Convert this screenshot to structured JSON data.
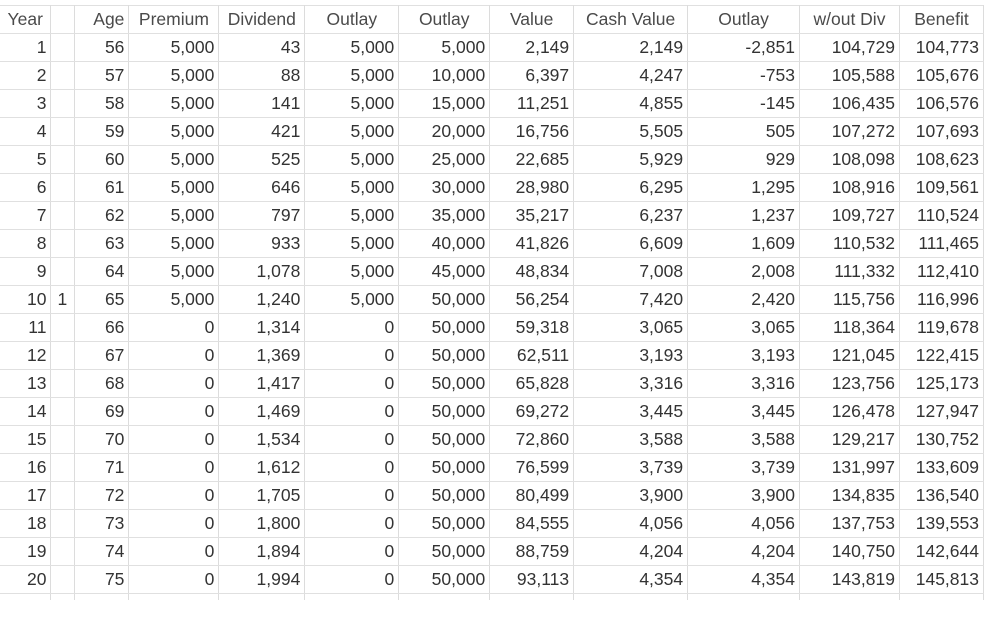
{
  "headers": [
    "Year",
    "",
    "Age",
    "Premium",
    "Dividend",
    "Outlay",
    "Outlay",
    "Value",
    "Cash Value",
    "Outlay",
    "w/out Div",
    "Benefit"
  ],
  "rows": [
    [
      "1",
      "",
      "56",
      "5,000",
      "43",
      "5,000",
      "5,000",
      "2,149",
      "2,149",
      "-2,851",
      "104,729",
      "104,773"
    ],
    [
      "2",
      "",
      "57",
      "5,000",
      "88",
      "5,000",
      "10,000",
      "6,397",
      "4,247",
      "-753",
      "105,588",
      "105,676"
    ],
    [
      "3",
      "",
      "58",
      "5,000",
      "141",
      "5,000",
      "15,000",
      "11,251",
      "4,855",
      "-145",
      "106,435",
      "106,576"
    ],
    [
      "4",
      "",
      "59",
      "5,000",
      "421",
      "5,000",
      "20,000",
      "16,756",
      "5,505",
      "505",
      "107,272",
      "107,693"
    ],
    [
      "5",
      "",
      "60",
      "5,000",
      "525",
      "5,000",
      "25,000",
      "22,685",
      "5,929",
      "929",
      "108,098",
      "108,623"
    ],
    [
      "6",
      "",
      "61",
      "5,000",
      "646",
      "5,000",
      "30,000",
      "28,980",
      "6,295",
      "1,295",
      "108,916",
      "109,561"
    ],
    [
      "7",
      "",
      "62",
      "5,000",
      "797",
      "5,000",
      "35,000",
      "35,217",
      "6,237",
      "1,237",
      "109,727",
      "110,524"
    ],
    [
      "8",
      "",
      "63",
      "5,000",
      "933",
      "5,000",
      "40,000",
      "41,826",
      "6,609",
      "1,609",
      "110,532",
      "111,465"
    ],
    [
      "9",
      "",
      "64",
      "5,000",
      "1,078",
      "5,000",
      "45,000",
      "48,834",
      "7,008",
      "2,008",
      "111,332",
      "112,410"
    ],
    [
      "10",
      "1",
      "65",
      "5,000",
      "1,240",
      "5,000",
      "50,000",
      "56,254",
      "7,420",
      "2,420",
      "115,756",
      "116,996"
    ],
    [
      "11",
      "",
      "66",
      "0",
      "1,314",
      "0",
      "50,000",
      "59,318",
      "3,065",
      "3,065",
      "118,364",
      "119,678"
    ],
    [
      "12",
      "",
      "67",
      "0",
      "1,369",
      "0",
      "50,000",
      "62,511",
      "3,193",
      "3,193",
      "121,045",
      "122,415"
    ],
    [
      "13",
      "",
      "68",
      "0",
      "1,417",
      "0",
      "50,000",
      "65,828",
      "3,316",
      "3,316",
      "123,756",
      "125,173"
    ],
    [
      "14",
      "",
      "69",
      "0",
      "1,469",
      "0",
      "50,000",
      "69,272",
      "3,445",
      "3,445",
      "126,478",
      "127,947"
    ],
    [
      "15",
      "",
      "70",
      "0",
      "1,534",
      "0",
      "50,000",
      "72,860",
      "3,588",
      "3,588",
      "129,217",
      "130,752"
    ],
    [
      "16",
      "",
      "71",
      "0",
      "1,612",
      "0",
      "50,000",
      "76,599",
      "3,739",
      "3,739",
      "131,997",
      "133,609"
    ],
    [
      "17",
      "",
      "72",
      "0",
      "1,705",
      "0",
      "50,000",
      "80,499",
      "3,900",
      "3,900",
      "134,835",
      "136,540"
    ],
    [
      "18",
      "",
      "73",
      "0",
      "1,800",
      "0",
      "50,000",
      "84,555",
      "4,056",
      "4,056",
      "137,753",
      "139,553"
    ],
    [
      "19",
      "",
      "74",
      "0",
      "1,894",
      "0",
      "50,000",
      "88,759",
      "4,204",
      "4,204",
      "140,750",
      "142,644"
    ],
    [
      "20",
      "",
      "75",
      "0",
      "1,994",
      "0",
      "50,000",
      "93,113",
      "4,354",
      "4,354",
      "143,819",
      "145,813"
    ]
  ]
}
